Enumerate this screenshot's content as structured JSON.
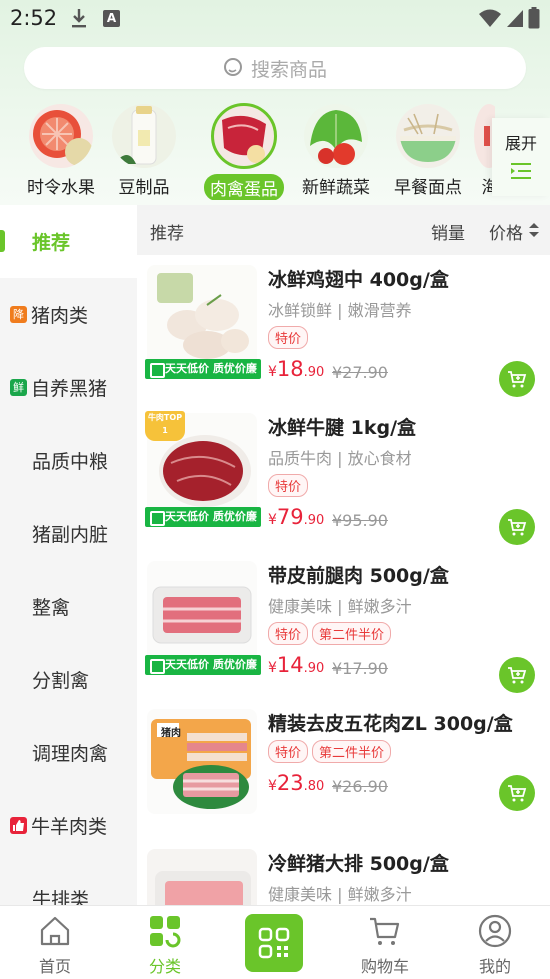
{
  "status_bar": {
    "time": "2:52",
    "notif_letter": "A"
  },
  "search": {
    "placeholder": "搜索商品"
  },
  "categories": [
    {
      "label": "时令水果",
      "active": false
    },
    {
      "label": "豆制品",
      "active": false
    },
    {
      "label": "肉禽蛋品",
      "active": true
    },
    {
      "label": "新鲜蔬菜",
      "active": false
    },
    {
      "label": "早餐面点",
      "active": false
    },
    {
      "label": "海",
      "active": false
    }
  ],
  "expand_label": "展开",
  "sidebar": {
    "items": [
      {
        "label": "推荐",
        "active": true,
        "badge": ""
      },
      {
        "label": "猪肉类",
        "active": false,
        "badge": "降"
      },
      {
        "label": "自养黑猪",
        "active": false,
        "badge": "鲜"
      },
      {
        "label": "品质中粮",
        "active": false,
        "badge": ""
      },
      {
        "label": "猪副内脏",
        "active": false,
        "badge": ""
      },
      {
        "label": "整禽",
        "active": false,
        "badge": ""
      },
      {
        "label": "分割禽",
        "active": false,
        "badge": ""
      },
      {
        "label": "调理肉禽",
        "active": false,
        "badge": ""
      },
      {
        "label": "牛羊肉类",
        "active": false,
        "badge": "thumb"
      },
      {
        "label": "牛排类",
        "active": false,
        "badge": ""
      }
    ],
    "badge_colors": {
      "降": "#f07c1d",
      "鲜": "#1aa64b",
      "thumb": "#e8233a"
    }
  },
  "sort_bar": {
    "recommend": "推荐",
    "sales": "销量",
    "price": "价格"
  },
  "products": [
    {
      "title": "冰鲜鸡翅中 400g/盒",
      "subtitle": "冰鲜锁鲜 | 嫩滑营养",
      "tags": [
        "特价"
      ],
      "price_yen": "¥",
      "price_int": "18",
      "price_dec": ".90",
      "old_price": "¥27.90",
      "promo": "天天低价 质优价廉"
    },
    {
      "title": "冰鲜牛腱 1kg/盒",
      "subtitle": "品质牛肉 | 放心食材",
      "tags": [
        "特价"
      ],
      "price_yen": "¥",
      "price_int": "79",
      "price_dec": ".90",
      "old_price": "¥95.90",
      "promo": "天天低价 质优价廉",
      "ribbon": "牛肉TOP 1"
    },
    {
      "title": "带皮前腿肉 500g/盒",
      "subtitle": "健康美味 | 鲜嫩多汁",
      "tags": [
        "特价",
        "第二件半价"
      ],
      "price_yen": "¥",
      "price_int": "14",
      "price_dec": ".90",
      "old_price": "¥17.90",
      "promo": "天天低价 质优价廉"
    },
    {
      "title": "精装去皮五花肉ZL 300g/盒",
      "subtitle": "",
      "tags": [
        "特价",
        "第二件半价"
      ],
      "price_yen": "¥",
      "price_int": "23",
      "price_dec": ".80",
      "old_price": "¥26.90",
      "promo": "",
      "package_label": "猪肉"
    },
    {
      "title": "冷鲜猪大排 500g/盒",
      "subtitle": "健康美味 | 鲜嫩多汁",
      "tags": [],
      "price_yen": "",
      "price_int": "",
      "price_dec": "",
      "old_price": "",
      "promo": ""
    }
  ],
  "bottom_nav": [
    {
      "label": "首页",
      "active": false
    },
    {
      "label": "分类",
      "active": true
    },
    {
      "label": "",
      "active": false
    },
    {
      "label": "购物车",
      "active": false
    },
    {
      "label": "我的",
      "active": false
    }
  ],
  "colors": {
    "accent": "#6ac52a",
    "price_red": "#e8233a",
    "promo_green": "#19b543"
  }
}
